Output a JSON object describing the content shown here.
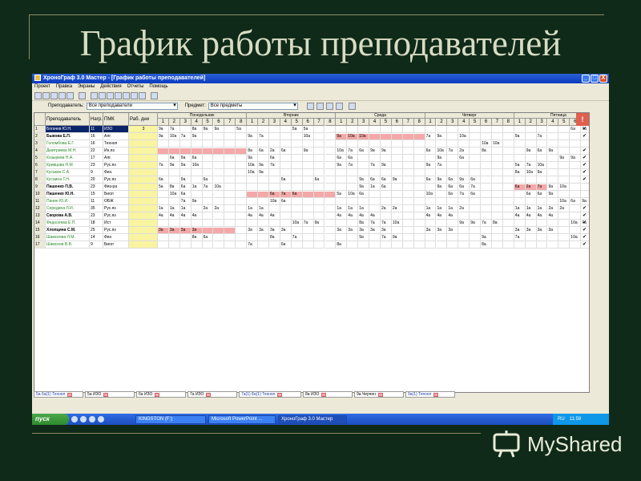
{
  "slide": {
    "title": "График работы преподавателей"
  },
  "window": {
    "title": "ХроноГраф 3.0 Мастер - [График работы преподавателей]",
    "buttons": [
      "_",
      "□",
      "X"
    ]
  },
  "menu": [
    "Проект",
    "Правка",
    "Экраны",
    "Действия",
    "Отчеты",
    "Помощь"
  ],
  "filters": {
    "teacher_label": "Преподаватель:",
    "teacher_value": "Все преподаватели",
    "subject_label": "Предмет:",
    "subject_value": "Все предметы"
  },
  "grid": {
    "columns": [
      "Преподаватель",
      "Нагр.",
      "ПМК",
      "Раб. дни"
    ],
    "days": [
      "Понедельник",
      "Вторник",
      "Среда",
      "Четверг",
      "Пятница"
    ],
    "periods": [
      "1",
      "2",
      "3",
      "4",
      "5",
      "6",
      "7",
      "8"
    ],
    "flag": "!",
    "rows": [
      {
        "n": "1",
        "name": "Богачев Ю.Н.",
        "load": "11",
        "subj": "ИЗО",
        "days": "3"
      },
      {
        "n": "2",
        "name": "Быкова Е.П.",
        "load": "16",
        "subj": "Алг.",
        "days": ""
      },
      {
        "n": "3",
        "name": "Голомбова Е.Г.",
        "load": "16",
        "subj": "Технол",
        "days": ""
      },
      {
        "n": "4",
        "name": "Дмитриева М.Н.",
        "load": "22",
        "subj": "Ин.яз",
        "days": ""
      },
      {
        "n": "5",
        "name": "Козырева Н.А.",
        "load": "17",
        "subj": "Алг.",
        "days": ""
      },
      {
        "n": "6",
        "name": "Кривцова Н.М.",
        "load": "23",
        "subj": "Рус.яз",
        "days": ""
      },
      {
        "n": "7",
        "name": "Кусакин С.А.",
        "load": "9",
        "subj": "Физ.",
        "days": ""
      },
      {
        "n": "8",
        "name": "Кусаина Т.Н.",
        "load": "20",
        "subj": "Рус.яз",
        "days": ""
      },
      {
        "n": "9",
        "name": "Пашенко П.В.",
        "load": "23",
        "subj": "Физ-ра",
        "days": ""
      },
      {
        "n": "10",
        "name": "Пашенко Ю.Н.",
        "load": "15",
        "subj": "Биол",
        "days": ""
      },
      {
        "n": "11",
        "name": "Панин Ю.И.",
        "load": "11",
        "subj": "ОБЖ",
        "days": ""
      },
      {
        "n": "12",
        "name": "Середина Л.И.",
        "load": "35",
        "subj": "Рус.яз",
        "days": ""
      },
      {
        "n": "13",
        "name": "Скорова А.В.",
        "load": "23",
        "subj": "Рус.яз",
        "days": ""
      },
      {
        "n": "14",
        "name": "Федосеева Е.П.",
        "load": "18",
        "subj": "Ист",
        "days": ""
      },
      {
        "n": "15",
        "name": "Хлопцина С.М.",
        "load": "25",
        "subj": "Рус.яз",
        "days": ""
      },
      {
        "n": "16",
        "name": "Шамсеева Л.М.",
        "load": "14",
        "subj": "Физ",
        "days": ""
      },
      {
        "n": "17",
        "name": "Шамсеев В.В.",
        "load": "9",
        "subj": "Биол",
        "days": ""
      }
    ],
    "schedule": [
      [
        [
          "9а",
          "7а",
          "",
          "8а",
          "9а",
          "9а",
          "",
          "5а"
        ],
        [
          "",
          "",
          "",
          "",
          "5а",
          "5а",
          "",
          ""
        ],
        [
          "",
          "",
          "",
          "",
          "",
          "",
          "",
          ""
        ],
        [
          "",
          "",
          "",
          "",
          "",
          "",
          "",
          ""
        ],
        [
          "",
          "",
          "",
          "",
          "",
          "6а",
          "7а",
          "7а"
        ]
      ],
      [
        [
          "9а",
          "10а",
          "7а",
          "9а",
          "",
          "",
          "",
          ""
        ],
        [
          "9а",
          "7а",
          "",
          "",
          "",
          "10а",
          "",
          ""
        ],
        [
          "9а",
          "10а",
          "10а",
          "",
          "",
          "",
          "",
          ""
        ],
        [
          "7а",
          "9а",
          "",
          "10а",
          "",
          "",
          "",
          ""
        ],
        [
          "9а",
          "",
          "7а",
          "",
          "",
          "",
          "",
          ""
        ]
      ],
      [
        [
          "",
          "",
          "",
          "",
          "",
          "",
          "",
          ""
        ],
        [
          "",
          "",
          "",
          "",
          "",
          "",
          "",
          ""
        ],
        [
          "",
          "",
          "",
          "",
          "",
          "",
          "",
          ""
        ],
        [
          "",
          "",
          "",
          "",
          "",
          "10а",
          "10а",
          ""
        ],
        [
          "",
          "",
          "",
          "",
          "",
          "",
          "",
          ""
        ]
      ],
      [
        [
          "",
          "",
          "",
          "",
          "",
          "",
          "",
          ""
        ],
        [
          "8а",
          "6а",
          "2а",
          "6а",
          "",
          "9а",
          "",
          ""
        ],
        [
          "10а",
          "7а",
          "6а",
          "9а",
          "9а",
          "",
          "",
          ""
        ],
        [
          "6а",
          "10а",
          "7а",
          "2а",
          "",
          "8а",
          "",
          ""
        ],
        [
          "",
          "9а",
          "6а",
          "9а",
          "",
          "",
          "",
          ""
        ]
      ],
      [
        [
          "",
          "6а",
          "9а",
          "6а",
          "",
          "",
          "",
          ""
        ],
        [
          "9а",
          "",
          "6а",
          "",
          "",
          "",
          "",
          ""
        ],
        [
          "6а",
          "6а",
          "",
          "",
          "",
          "",
          "",
          ""
        ],
        [
          "",
          "9а",
          "",
          "6а",
          "",
          "",
          "",
          ""
        ],
        [
          "",
          "",
          "",
          "",
          "9а",
          "9а",
          "",
          ""
        ]
      ],
      [
        [
          "7а",
          "9а",
          "9а",
          "10а",
          "",
          "",
          "",
          ""
        ],
        [
          "10а",
          "9а",
          "7а",
          "",
          "",
          "",
          "",
          ""
        ],
        [
          "9а",
          "7а",
          "",
          "7а",
          "9а",
          "",
          "",
          ""
        ],
        [
          "9а",
          "7а",
          "",
          "",
          "",
          "",
          "",
          ""
        ],
        [
          "5а",
          "7а",
          "10а",
          "",
          "",
          "",
          "",
          ""
        ]
      ],
      [
        [
          "",
          "",
          "",
          "",
          "",
          "",
          "",
          ""
        ],
        [
          "10а",
          "9а",
          "",
          "",
          "",
          "",
          "",
          ""
        ],
        [
          "",
          "",
          "",
          "",
          "",
          "",
          "",
          ""
        ],
        [
          "",
          "",
          "",
          "",
          "",
          "",
          "",
          ""
        ],
        [
          "8а",
          "10а",
          "9а",
          "",
          "",
          "",
          "",
          ""
        ]
      ],
      [
        [
          "6а",
          "",
          "9а",
          "",
          "6а",
          "",
          "",
          ""
        ],
        [
          "",
          "",
          "",
          "6а",
          "",
          "",
          "6а",
          ""
        ],
        [
          "",
          "",
          "9а",
          "6а",
          "6а",
          "9а",
          "",
          ""
        ],
        [
          "6а",
          "9а",
          "6а",
          "9а",
          "6а",
          "",
          "",
          ""
        ],
        [
          "",
          "",
          "",
          "",
          "",
          "",
          "",
          ""
        ]
      ],
      [
        [
          "5а",
          "8а",
          "6а",
          "1а",
          "7а",
          "10а",
          "",
          ""
        ],
        [
          "",
          "",
          "",
          "",
          "",
          "",
          "",
          ""
        ],
        [
          "",
          "",
          "9а",
          "1а",
          "6а",
          "",
          "",
          ""
        ],
        [
          "",
          "9а",
          "6а",
          "6а",
          "7а",
          "",
          "",
          ""
        ],
        [
          "6а",
          "2а",
          "7а",
          "9а",
          "10а",
          "",
          "",
          ""
        ]
      ],
      [
        [
          "",
          "10а",
          "6а",
          "",
          "",
          "",
          "",
          ""
        ],
        [
          "",
          "",
          "6а",
          "7а",
          "6а",
          "",
          "",
          ""
        ],
        [
          "5а",
          "10а",
          "6а",
          "",
          "",
          "",
          "",
          ""
        ],
        [
          "10а",
          "",
          "6а",
          "7а",
          "6а",
          "",
          "",
          ""
        ],
        [
          "",
          "6а",
          "6а",
          "9а",
          "",
          "",
          "",
          ""
        ]
      ],
      [
        [
          "",
          "",
          "7а",
          "9а",
          "",
          "",
          "",
          ""
        ],
        [
          "",
          "",
          "10а",
          "6а",
          "",
          "",
          "",
          ""
        ],
        [
          "",
          "",
          "",
          "",
          "",
          "",
          "",
          ""
        ],
        [
          "",
          "",
          "",
          "",
          "",
          "",
          "",
          ""
        ],
        [
          "",
          "",
          "",
          "",
          "10а",
          "6а",
          "9а",
          ""
        ]
      ],
      [
        [
          "1а",
          "1а",
          "1а",
          "",
          "2а",
          "2а",
          "",
          ""
        ],
        [
          "1а",
          "1а",
          "",
          "",
          "",
          "",
          "",
          ""
        ],
        [
          "1а",
          "1а",
          "1а",
          "",
          "2а",
          "2а",
          "",
          ""
        ],
        [
          "1а",
          "1а",
          "1а",
          "2а",
          "",
          "",
          "",
          ""
        ],
        [
          "1а",
          "1а",
          "1а",
          "2а",
          "2а",
          "",
          "",
          ""
        ]
      ],
      [
        [
          "4а",
          "4а",
          "4а",
          "4а",
          "",
          "",
          "",
          ""
        ],
        [
          "4а",
          "4а",
          "4а",
          "",
          "",
          "",
          "",
          ""
        ],
        [
          "4а",
          "4а",
          "4а",
          "4а",
          "",
          "",
          "",
          ""
        ],
        [
          "4а",
          "4а",
          "4а",
          "",
          "",
          "",
          "",
          ""
        ],
        [
          "4а",
          "4а",
          "4а",
          "4а",
          "",
          "",
          "",
          ""
        ]
      ],
      [
        [
          "",
          "",
          "",
          "",
          "",
          "",
          "",
          ""
        ],
        [
          "",
          "",
          "",
          "",
          "10а",
          "7а",
          "9а",
          ""
        ],
        [
          "",
          "",
          "8а",
          "7а",
          "7а",
          "10а",
          "",
          ""
        ],
        [
          "",
          "",
          "",
          "9а",
          "9а",
          "7а",
          "8а",
          ""
        ],
        [
          "",
          "",
          "",
          "",
          "",
          "10а",
          "7а",
          ""
        ]
      ],
      [
        [
          "3а",
          "3а",
          "3а",
          "3а",
          "",
          "",
          "",
          ""
        ],
        [
          "3а",
          "3а",
          "3а",
          "3а",
          "",
          "",
          "",
          ""
        ],
        [
          "3а",
          "3а",
          "3а",
          "3а",
          "3а",
          "",
          "",
          ""
        ],
        [
          "3а",
          "3а",
          "3а",
          "",
          "",
          "",
          "",
          ""
        ],
        [
          "3а",
          "3а",
          "3а",
          "3а",
          "",
          "",
          "",
          ""
        ]
      ],
      [
        [
          "",
          "",
          "",
          "8а",
          "6а",
          "",
          "",
          ""
        ],
        [
          "",
          "",
          "8а",
          "",
          "7а",
          "",
          "",
          ""
        ],
        [
          "",
          "",
          "9а",
          "",
          "7а",
          "9а",
          "",
          ""
        ],
        [
          "",
          "",
          "",
          "",
          "",
          "9а",
          "",
          ""
        ],
        [
          "7а",
          "",
          "",
          "",
          "",
          "10а",
          "",
          ""
        ]
      ],
      [
        [
          "",
          "",
          "",
          "",
          "",
          "",
          "",
          ""
        ],
        [
          "7а",
          "",
          "",
          "6а",
          "",
          "",
          "",
          ""
        ],
        [
          "8а",
          "",
          "",
          "",
          "",
          "",
          "",
          ""
        ],
        [
          "",
          "",
          "",
          "",
          "",
          "8а",
          "",
          ""
        ],
        [
          "",
          "",
          "",
          "",
          "",
          "",
          "",
          ""
        ]
      ]
    ],
    "pink": [
      [
        1,
        0,
        4,
        8
      ],
      [
        1,
        2,
        1,
        7
      ],
      [
        4,
        0,
        1,
        8
      ],
      [
        9,
        0,
        4,
        5
      ],
      [
        9,
        1,
        1,
        8
      ],
      [
        14,
        0,
        4,
        7
      ],
      [
        9,
        4,
        5,
        8
      ]
    ]
  },
  "lessons": [
    "5а 6а(1) Технол",
    "5а ИЗО",
    "6а ИЗО",
    "7а ИЗО",
    "7а(1) 8а(1) Технол",
    "8а ИЗО",
    "9а Черчен",
    "9а(1) Технол"
  ],
  "taskbar": {
    "start": "пуск",
    "tasks": [
      "KINGSTON (F:)",
      "Microsoft PowerPoint ...",
      "ХроноГраф 3.0 Мастер"
    ],
    "lang": "RU",
    "time": "11:59"
  },
  "logo": {
    "text": "MyShared"
  }
}
